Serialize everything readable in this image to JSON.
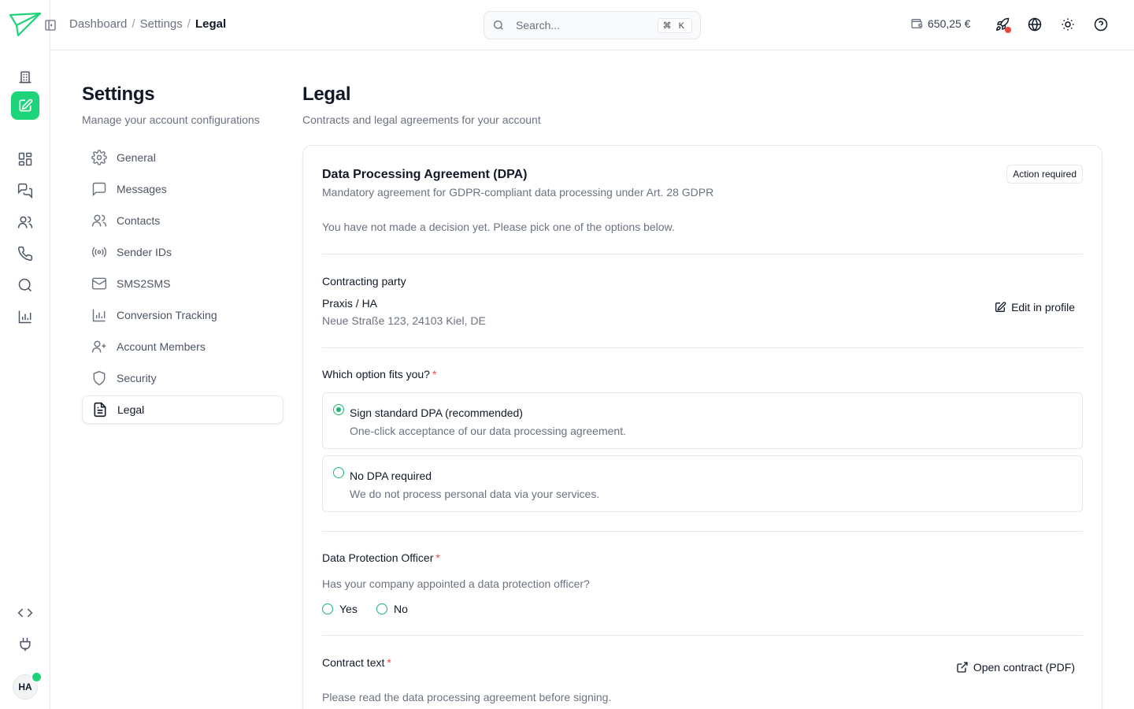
{
  "breadcrumb": [
    "Dashboard",
    "Settings",
    "Legal"
  ],
  "search": {
    "placeholder": "Search...",
    "shortcut": "⌘ K"
  },
  "balance": "650,25 €",
  "settings": {
    "title": "Settings",
    "subtitle": "Manage your account configurations",
    "nav": [
      {
        "label": "General",
        "icon": "gear-icon"
      },
      {
        "label": "Messages",
        "icon": "message-icon"
      },
      {
        "label": "Contacts",
        "icon": "users-icon"
      },
      {
        "label": "Sender IDs",
        "icon": "broadcast-icon"
      },
      {
        "label": "SMS2SMS",
        "icon": "mail-icon"
      },
      {
        "label": "Conversion Tracking",
        "icon": "bar-chart-icon"
      },
      {
        "label": "Account Members",
        "icon": "user-plus-icon"
      },
      {
        "label": "Security",
        "icon": "shield-icon"
      },
      {
        "label": "Legal",
        "icon": "document-icon",
        "active": true
      }
    ]
  },
  "legal": {
    "title": "Legal",
    "subtitle": "Contracts and legal agreements for your account"
  },
  "dpa": {
    "title": "Data Processing Agreement (DPA)",
    "subtitle": "Mandatory agreement for GDPR-compliant data processing under Art. 28 GDPR",
    "badge": "Action required",
    "note": "You have not made a decision yet. Please pick one of the options below.",
    "party_label": "Contracting party",
    "party_name": "Praxis / HA",
    "party_address": "Neue Straße 123, 24103 Kiel, DE",
    "edit_label": "Edit in profile",
    "option_question": "Which option fits you?",
    "required_mark": "*",
    "options": [
      {
        "title": "Sign standard DPA (recommended)",
        "desc": "One-click acceptance of our data processing agreement.",
        "selected": true
      },
      {
        "title": "No DPA required",
        "desc": "We do not process personal data via your services.",
        "selected": false
      }
    ],
    "dpo_label": "Data Protection Officer",
    "dpo_question": "Has your company appointed a data protection officer?",
    "dpo_yes": "Yes",
    "dpo_no": "No",
    "contract_label": "Contract text",
    "open_contract_label": "Open contract (PDF)",
    "contract_note": "Please read the data processing agreement before signing."
  },
  "user": {
    "initials": "HA"
  },
  "colors": {
    "accent": "#1ED47A",
    "radio": "#1FB574",
    "required": "#EF4444",
    "notification": "#EF4444"
  }
}
